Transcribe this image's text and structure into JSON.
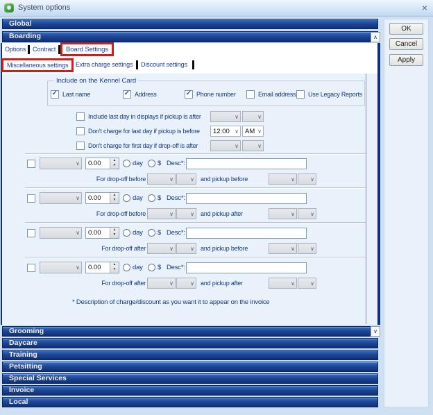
{
  "colors": {
    "header_blue": "#1c4496",
    "annotation_red": "#c9201d",
    "panel_blue": "#e9f1fb",
    "title_text": "#3c4c63"
  },
  "icons": {
    "close": "×",
    "chevron_down": "∨",
    "chevron_up": "∧",
    "check": "✓",
    "spinner_up": "▲",
    "spinner_down": "▼"
  },
  "window": {
    "title": "System options"
  },
  "side_panel": {
    "ok": "OK",
    "cancel": "Cancel",
    "apply": "Apply"
  },
  "sections": {
    "global": "Global",
    "boarding": "Boarding",
    "bottom": [
      "Grooming",
      "Daycare",
      "Training",
      "Petsitting",
      "Special Services",
      "Invoice",
      "Local"
    ]
  },
  "tabs": {
    "options": "Options",
    "contract": "Contract",
    "board_settings": "Board Settings"
  },
  "subtabs": {
    "misc": "Miscellaneous settings",
    "extra": "Extra charge settings",
    "discount": "Discount settings"
  },
  "kennel_card": {
    "title": "Include on the Kennel Card",
    "items": [
      {
        "label": "Last name",
        "mark": "✓"
      },
      {
        "label": "Address",
        "mark": "✓"
      },
      {
        "label": "Phone number",
        "mark": "✓"
      },
      {
        "label": "Email address",
        "mark": ""
      },
      {
        "label": "Use Legacy Reports",
        "mark": ""
      }
    ]
  },
  "day_rules": [
    {
      "label": "Include last day in displays if pickup is after",
      "time": "",
      "ampm": ""
    },
    {
      "label": "Don't charge for last day if pickup is before",
      "time": "12:00",
      "ampm": "AM"
    },
    {
      "label": "Don't charge for first day if drop-off is after",
      "time": "",
      "ampm": ""
    }
  ],
  "charge_rows": [
    {
      "amount": "0.00",
      "day_label": "day",
      "dollar_label": "$",
      "desc_label": "Desc*:",
      "desc_value": "",
      "dropoff_label": "For drop-off before",
      "pickup_label": "and pickup before"
    },
    {
      "amount": "0.00",
      "day_label": "day",
      "dollar_label": "$",
      "desc_label": "Desc*:",
      "desc_value": "",
      "dropoff_label": "For drop-off before",
      "pickup_label": "and pickup after"
    },
    {
      "amount": "0.00",
      "day_label": "day",
      "dollar_label": "$",
      "desc_label": "Desc*:",
      "desc_value": "",
      "dropoff_label": "For drop-off after",
      "pickup_label": "and pickup before"
    },
    {
      "amount": "0.00",
      "day_label": "day",
      "dollar_label": "$",
      "desc_label": "Desc*:",
      "desc_value": "",
      "dropoff_label": "For drop-off after",
      "pickup_label": "and pickup after"
    }
  ],
  "footnote": "* Description of charge/discount as you want it to appear on the invoice"
}
